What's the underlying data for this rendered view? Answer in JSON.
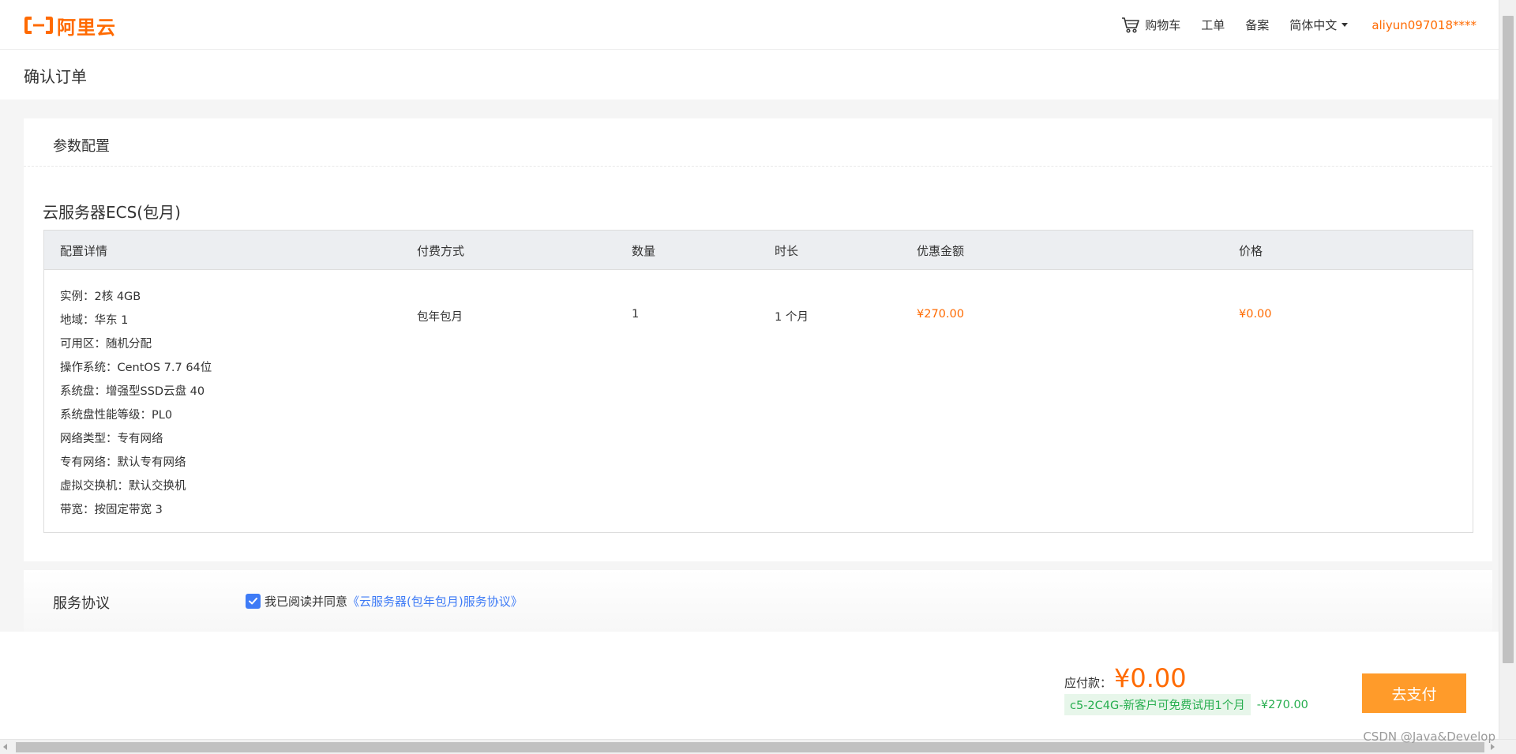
{
  "header": {
    "logo_text": "阿里云",
    "nav": {
      "cart": "购物车",
      "ticket": "工单",
      "filing": "备案",
      "language": "简体中文",
      "user": "aliyun097018****"
    }
  },
  "page": {
    "title": "确认订单"
  },
  "config": {
    "section_title": "参数配置",
    "product_title": "云服务器ECS(包月)",
    "columns": [
      "配置详情",
      "付费方式",
      "数量",
      "时长",
      "优惠金额",
      "价格"
    ],
    "specs": [
      "实例：2核 4GB",
      "地域：华东 1",
      "可用区：随机分配",
      "操作系统：CentOS 7.7 64位",
      "系统盘：增强型SSD云盘 40",
      "系统盘性能等级：PL0",
      "网络类型：专有网络",
      "专有网络：默认专有网络",
      "虚拟交换机：默认交换机",
      "带宽：按固定带宽 3"
    ],
    "billing": "包年包月",
    "quantity": "1",
    "duration": "1 个月",
    "discount": "¥270.00",
    "price": "¥0.00"
  },
  "agreement": {
    "title": "服务协议",
    "checkbox_checked": true,
    "text": "我已阅读并同意",
    "link": "《云服务器(包年包月)服务协议》"
  },
  "footer": {
    "due_label": "应付款：",
    "due_amount": "¥0.00",
    "promo_tag": "c5-2C4G-新客户可免费试用1个月",
    "promo_value": "-¥270.00",
    "pay_button": "去支付"
  },
  "watermark": "CSDN @Java&Develop",
  "colors": {
    "brand": "#ff6a00",
    "pay_button": "#ff9b2a",
    "link": "#3e7bf6",
    "promo": "#27ae4f"
  }
}
